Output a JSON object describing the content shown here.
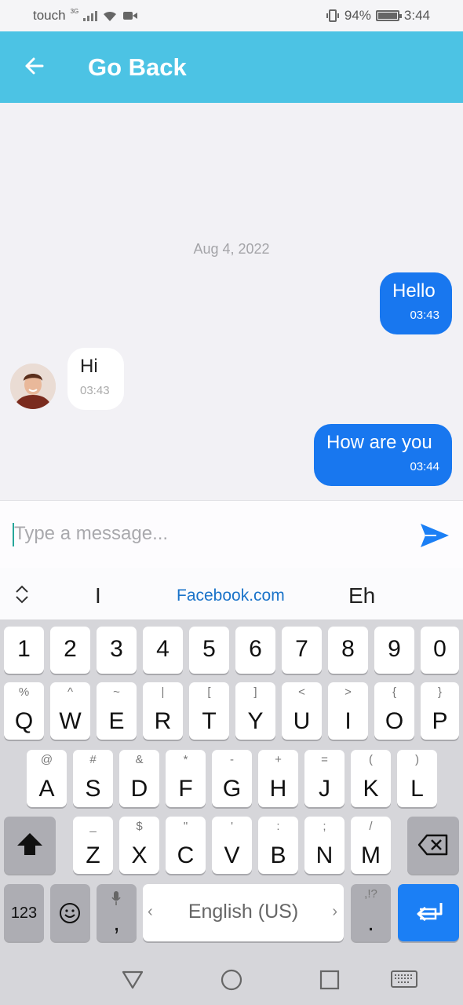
{
  "status_bar": {
    "carrier": "touch",
    "network": "3G",
    "battery": "94%",
    "time": "3:44"
  },
  "header": {
    "back_icon": "arrow-left-icon",
    "title": "Go Back",
    "color": "#4cc3e4"
  },
  "chat": {
    "date": "Aug 4, 2022",
    "messages": [
      {
        "direction": "outgoing",
        "text": "Hello",
        "time": "03:43"
      },
      {
        "direction": "incoming",
        "text": "Hi",
        "time": "03:43"
      },
      {
        "direction": "outgoing",
        "text": "How are you",
        "time": "03:44"
      }
    ],
    "outgoing_color": "#1877ef"
  },
  "composer": {
    "placeholder": "Type a message...",
    "value": "",
    "send_icon": "send-icon"
  },
  "suggestions": {
    "items": [
      "I",
      "Facebook.com",
      "Eh"
    ]
  },
  "keyboard": {
    "number_row": [
      "1",
      "2",
      "3",
      "4",
      "5",
      "6",
      "7",
      "8",
      "9",
      "0"
    ],
    "row1": {
      "keys": [
        "Q",
        "W",
        "E",
        "R",
        "T",
        "Y",
        "U",
        "I",
        "O",
        "P"
      ],
      "subs": [
        "%",
        "^",
        "~",
        "|",
        "[",
        "]",
        "<",
        ">",
        "{",
        "}"
      ]
    },
    "row2": {
      "keys": [
        "A",
        "S",
        "D",
        "F",
        "G",
        "H",
        "J",
        "K",
        "L"
      ],
      "subs": [
        "@",
        "#",
        "&",
        "*",
        "-",
        "+",
        "=",
        "(",
        ")"
      ]
    },
    "row3": {
      "keys": [
        "Z",
        "X",
        "C",
        "V",
        "B",
        "N",
        "M"
      ],
      "subs": [
        "_",
        "$",
        "\"",
        "'",
        ":",
        ";",
        "/"
      ]
    },
    "bottom": {
      "symbols": "123",
      "comma": ",",
      "space": "English (US)",
      "period": ".",
      "period_sub": ",!?"
    },
    "accent_color": "#1b7ff5"
  }
}
